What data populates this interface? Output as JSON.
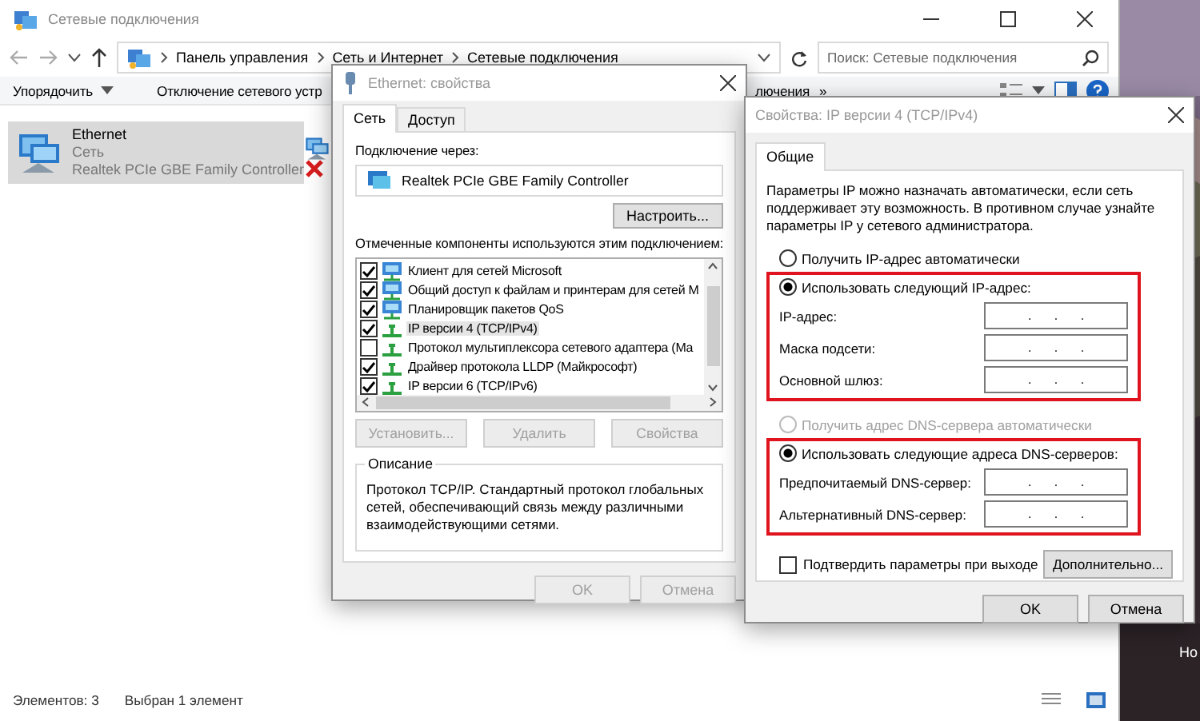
{
  "explorer": {
    "title": "Сетевые подключения",
    "breadcrumb": [
      "Панель управления",
      "Сеть и Интернет",
      "Сетевые подключения"
    ],
    "search": {
      "placeholder": "Поиск: Сетевые подключения"
    },
    "toolbar": [
      {
        "label": "Упорядочить",
        "kind": "menu"
      },
      {
        "label": "Отключение сетевого устр",
        "kind": "command"
      },
      {
        "label": "лючения",
        "kind": "command"
      },
      {
        "label": "»",
        "kind": "overflow"
      }
    ],
    "connections": [
      {
        "name": "Ethernet",
        "status": "Сеть",
        "device": "Realtek PCIe GBE Family Controller",
        "selected": true,
        "disconnected": false
      },
      {
        "selected": false,
        "disconnected": true
      }
    ],
    "status_bar": [
      "Элементов: 3",
      "Выбран 1 элемент"
    ]
  },
  "desktop": {
    "label": "Но"
  },
  "ethernet_dialog": {
    "title": "Ethernet: свойства",
    "tabs": [
      {
        "label": "Сеть",
        "selected": true
      },
      {
        "label": "Доступ",
        "selected": false
      }
    ],
    "connect_via_label": "Подключение через:",
    "adapter": "Realtek PCIe GBE Family Controller",
    "configure_button": "Настроить...",
    "components_label": "Отмеченные компоненты используются этим подключением:",
    "components": [
      {
        "label": "Клиент для сетей Microsoft",
        "checked": true,
        "kind": "client",
        "selected": false
      },
      {
        "label": "Общий доступ к файлам и принтерам для сетей M",
        "checked": true,
        "kind": "client",
        "selected": false
      },
      {
        "label": "Планировщик пакетов QoS",
        "checked": true,
        "kind": "client",
        "selected": false
      },
      {
        "label": "IP версии 4 (TCP/IPv4)",
        "checked": true,
        "kind": "protocol",
        "selected": true
      },
      {
        "label": "Протокол мультиплексора сетевого адаптера (Ма",
        "checked": false,
        "kind": "protocol",
        "selected": false
      },
      {
        "label": "Драйвер протокола LLDP (Майкрософт)",
        "checked": true,
        "kind": "protocol",
        "selected": false
      },
      {
        "label": "IP версии 6 (TCP/IPv6)",
        "checked": true,
        "kind": "protocol",
        "selected": false
      }
    ],
    "buttons": [
      {
        "label": "Установить...",
        "disabled": true
      },
      {
        "label": "Удалить",
        "disabled": true
      },
      {
        "label": "Свойства",
        "disabled": true
      }
    ],
    "description": {
      "title": "Описание",
      "text": "Протокол TCP/IP. Стандартный протокол глобальных сетей, обеспечивающий связь между различными взаимодействующими сетями."
    },
    "footer": [
      {
        "label": "OK",
        "disabled": true
      },
      {
        "label": "Отмена",
        "disabled": true
      }
    ]
  },
  "ipv4_dialog": {
    "title": "Свойства: IP версии 4 (TCP/IPv4)",
    "tabs": [
      {
        "label": "Общие",
        "selected": true
      }
    ],
    "intro": "Параметры IP можно назначать автоматически, если сеть поддерживает эту возможность. В противном случае узнайте параметры IP у сетевого администратора.",
    "ip_auto": {
      "label": "Получить IP-адрес автоматически",
      "selected": false,
      "disabled": false
    },
    "ip_manual": {
      "label": "Использовать следующий IP-адрес:",
      "selected": true,
      "disabled": false,
      "highlight": true,
      "fields": [
        {
          "label": "IP-адрес:",
          "value": ". . ."
        },
        {
          "label": "Маска подсети:",
          "value": ". . ."
        },
        {
          "label": "Основной шлюз:",
          "value": ". . ."
        }
      ]
    },
    "dns_auto": {
      "label": "Получить адрес DNS-сервера автоматически",
      "selected": false,
      "disabled": true
    },
    "dns_manual": {
      "label": "Использовать следующие адреса DNS-серверов:",
      "selected": true,
      "disabled": false,
      "highlight": true,
      "fields": [
        {
          "label": "Предпочитаемый DNS-сервер:",
          "value": ". . ."
        },
        {
          "label": "Альтернативный DNS-сервер:",
          "value": ". . ."
        }
      ]
    },
    "validate": {
      "label": "Подтвердить параметры при выходе",
      "checked": false
    },
    "advanced_button": "Дополнительно...",
    "footer": [
      {
        "label": "OK",
        "disabled": false
      },
      {
        "label": "Отмена",
        "disabled": false
      }
    ]
  }
}
